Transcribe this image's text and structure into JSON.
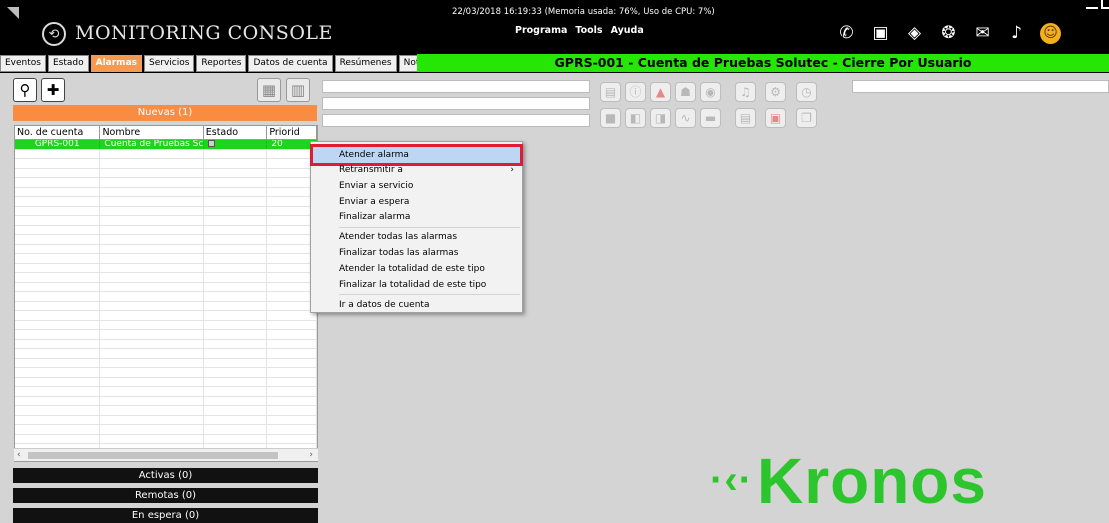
{
  "window": {
    "title": "MONITORING CONSOLE",
    "status_line": "22/03/2018 16:19:33 (Memoria usada: 76%, Uso de CPU: 7%)",
    "menu": [
      "Programa",
      "Tools",
      "Ayuda"
    ]
  },
  "title_icons": [
    "phone-icon",
    "card-icon",
    "shield-icon",
    "owl-icon",
    "chat-icon",
    "speaker-icon",
    "smiley-icon"
  ],
  "tabs": [
    {
      "label": "Eventos",
      "active": false
    },
    {
      "label": "Estado",
      "active": false
    },
    {
      "label": "Alarmas",
      "active": true
    },
    {
      "label": "Servicios",
      "active": false
    },
    {
      "label": "Reportes",
      "active": false
    },
    {
      "label": "Datos de cuenta",
      "active": false
    },
    {
      "label": "Resúmenes",
      "active": false
    },
    {
      "label": "Notas",
      "active": false
    }
  ],
  "account_banner": "GPRS-001  -  Cuenta de Pruebas Solutec - Cierre Por Usuario",
  "left_panel": {
    "nuevas_header": "Nuevas (1)",
    "columns": [
      "No. de cuenta",
      "Nombre",
      "Estado",
      "Priorid"
    ],
    "rows": [
      {
        "account": "GPRS-001",
        "name": "Cuenta de Pruebas Sc",
        "priority": "20"
      }
    ],
    "activas": "Activas (0)",
    "remotas": "Remotas (0)",
    "en_espera": "En espera (0)"
  },
  "context_menu": {
    "items": [
      {
        "label": "Atender alarma",
        "highlighted": true
      },
      {
        "label": "Retransmitir a",
        "submenu": true
      },
      {
        "label": "Enviar a servicio"
      },
      {
        "label": "Enviar a espera"
      },
      {
        "label": "Finalizar alarma"
      },
      {
        "label": "Atender todas las alarmas"
      },
      {
        "label": "Finalizar todas las alarmas"
      },
      {
        "label": "Atender la totalidad de este tipo"
      },
      {
        "label": "Finalizar la totalidad de este tipo"
      },
      {
        "label": "Ir a datos de cuenta"
      }
    ]
  },
  "logo": {
    "text": "Kronos",
    "color": "#2dc52d"
  },
  "colors": {
    "accent_orange": "#f78c42",
    "banner_green": "#25e605",
    "selected_row": "#1fd41f",
    "highlight_border": "#e01b35"
  }
}
